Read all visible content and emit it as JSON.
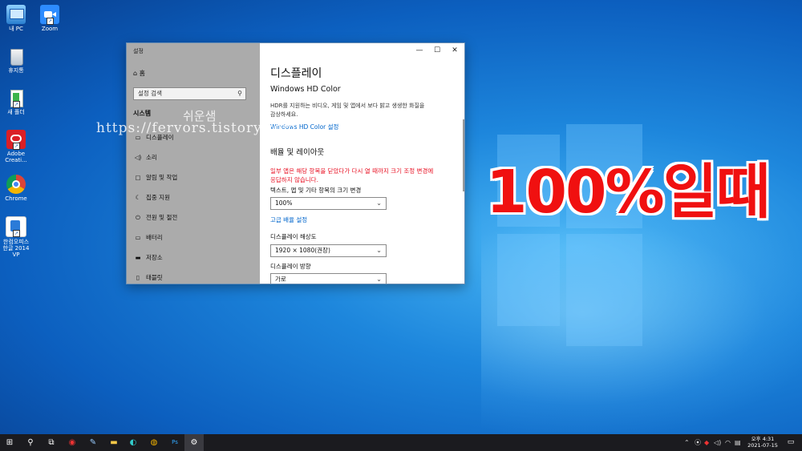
{
  "desktop": {
    "icons": [
      {
        "label": "내 PC",
        "icon": "this-pc-icon"
      },
      {
        "label": "Zoom",
        "icon": "zoom-icon"
      },
      {
        "label": "휴지통",
        "icon": "recycle-bin-icon"
      },
      {
        "label": "새 폴더",
        "icon": "folder-icon"
      },
      {
        "label": "Adobe Creati...",
        "icon": "adobe-creative-cloud-icon"
      },
      {
        "label": "Chrome",
        "icon": "chrome-icon"
      },
      {
        "label": "한컴오피스 한글 2014 VP",
        "icon": "hancom-office-icon"
      }
    ],
    "overlay_text": "100%일때",
    "watermark_text": "https://fervors.tistory.com",
    "watermark_korean": "쉬운샘"
  },
  "window": {
    "title": "설정",
    "controls": {
      "minimize": "—",
      "maximize": "☐",
      "close": "✕"
    },
    "sidebar": {
      "home_label": "홈",
      "search_placeholder": "설정 검색",
      "section": "시스템",
      "items": [
        {
          "label": "디스플레이",
          "icon": "display-icon"
        },
        {
          "label": "소리",
          "icon": "sound-icon"
        },
        {
          "label": "알림 및 작업",
          "icon": "notifications-icon"
        },
        {
          "label": "집중 지원",
          "icon": "focus-assist-icon"
        },
        {
          "label": "전원 및 절전",
          "icon": "power-icon"
        },
        {
          "label": "배터리",
          "icon": "battery-icon"
        },
        {
          "label": "저장소",
          "icon": "storage-icon"
        },
        {
          "label": "태블릿",
          "icon": "tablet-icon"
        }
      ]
    },
    "main": {
      "title": "디스플레이",
      "hdr_heading": "Windows HD Color",
      "hdr_desc_line1": "HDR를 지원하는 비디오, 게임 및 앱에서 보다 밝고 생생한 화질을",
      "hdr_desc_line2": "감상하세요.",
      "hdr_link": "Windows HD Color 설정",
      "scale_heading": "배율 및 레이아웃",
      "warning_line1": "일부 앱은 해당 항목을 닫았다가 다시 열 때까지 크기 조정 변경에",
      "warning_line2": "응답하지 않습니다.",
      "scale_label": "텍스트, 앱 및 기타 항목의 크기 변경",
      "scale_value": "100%",
      "advanced_link": "고급 배율 설정",
      "resolution_label": "디스플레이 해상도",
      "resolution_value": "1920 × 1080(권장)",
      "orientation_label": "디스플레이 방향",
      "orientation_value": "가로"
    }
  },
  "taskbar": {
    "apps": [
      {
        "name": "start-button",
        "glyph": "⊞"
      },
      {
        "name": "search-button",
        "glyph": "⚲"
      },
      {
        "name": "task-view-button",
        "glyph": "⧉"
      },
      {
        "name": "app-red",
        "glyph": "◉"
      },
      {
        "name": "app-feather",
        "glyph": "✎"
      },
      {
        "name": "file-explorer",
        "glyph": "▬"
      },
      {
        "name": "edge",
        "glyph": "◐"
      },
      {
        "name": "chrome",
        "glyph": "◍"
      },
      {
        "name": "photoshop",
        "glyph": "Ps"
      },
      {
        "name": "settings",
        "glyph": "⚙"
      }
    ],
    "tray": {
      "chevron": "⌃",
      "time": "오후 4:31",
      "date": "2021-07-15"
    }
  }
}
